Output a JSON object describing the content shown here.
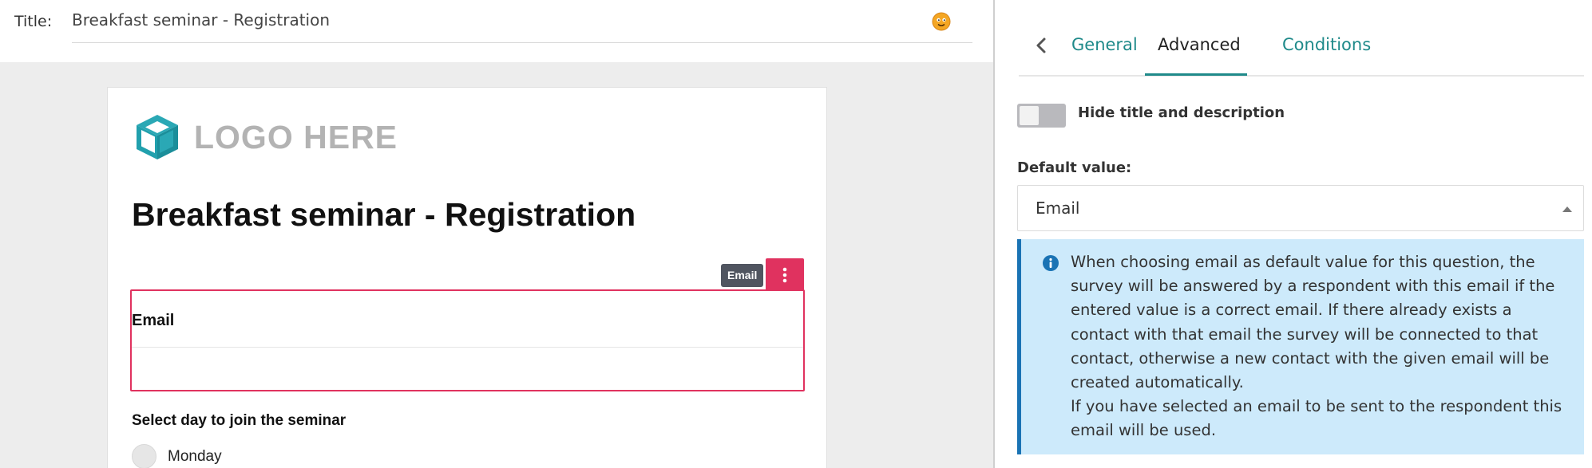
{
  "editor": {
    "title_label": "Title:",
    "title_value": "Breakfast seminar - Registration"
  },
  "survey": {
    "logo_text": "LOGO HERE",
    "heading": "Breakfast seminar - Registration",
    "selected_question": {
      "type_tag": "Email",
      "label": "Email"
    },
    "question2": {
      "label": "Select day to join the seminar",
      "options": [
        "Monday"
      ]
    }
  },
  "settings": {
    "tabs": [
      "General",
      "Advanced",
      "Conditions"
    ],
    "active_tab": "Advanced",
    "hide_title": {
      "label": "Hide title and description",
      "enabled": false
    },
    "default_value": {
      "label": "Default value:",
      "selected": "Email"
    },
    "info": {
      "paragraph1": "When choosing email as default value for this question, the survey will be answered by a respondent with this email if the entered value is a correct email. If there already exists a contact with that email the survey will be connected to that contact, otherwise a new contact with the given email will be created automatically.",
      "paragraph2": "If you have selected an email to be sent to the respondent this email will be used."
    }
  },
  "colors": {
    "accent_teal": "#1f8a8a",
    "selection_pink": "#e0325f",
    "info_background": "#cdeafb",
    "info_border": "#1a73b4"
  }
}
